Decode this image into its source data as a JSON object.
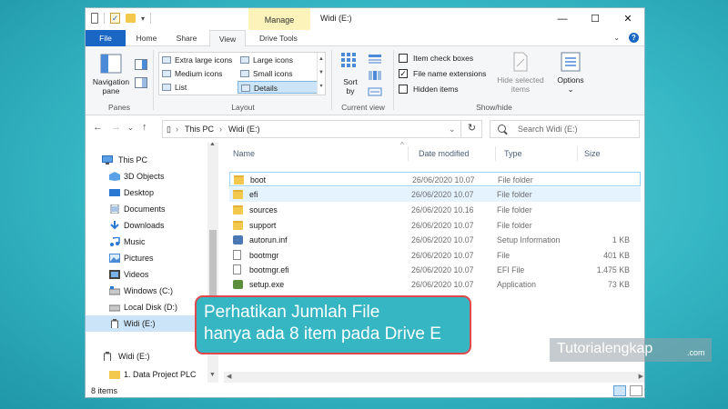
{
  "window": {
    "title": "Widi (E:)",
    "context_tab": "Manage",
    "minimize": "—",
    "maximize": "☐",
    "close": "✕"
  },
  "ribbon_tabs": [
    "File",
    "Home",
    "Share",
    "View",
    "Drive Tools"
  ],
  "ribbon": {
    "panes": {
      "nav_pane_label": "Navigation\npane",
      "group": "Panes"
    },
    "layout": {
      "items": [
        "Extra large icons",
        "Large icons",
        "Medium icons",
        "Small icons",
        "List",
        "Details"
      ],
      "selected": "Details",
      "group": "Layout"
    },
    "current_view": {
      "sort_label": "Sort\nby",
      "group": "Current view"
    },
    "show_hide": {
      "checkboxes": [
        {
          "label": "Item check boxes",
          "checked": false
        },
        {
          "label": "File name extensions",
          "checked": true
        },
        {
          "label": "Hidden items",
          "checked": false
        }
      ],
      "hide_selected": "Hide selected\nitems",
      "options": "Options",
      "group": "Show/hide"
    }
  },
  "address": {
    "segments": [
      "This PC",
      "Widi (E:)"
    ],
    "search_placeholder": "Search Widi (E:)"
  },
  "nav": {
    "items": [
      {
        "label": "This PC",
        "icon": "computer-icon"
      },
      {
        "label": "3D Objects",
        "icon": "cube-icon"
      },
      {
        "label": "Desktop",
        "icon": "desktop-icon"
      },
      {
        "label": "Documents",
        "icon": "documents-icon"
      },
      {
        "label": "Downloads",
        "icon": "download-icon"
      },
      {
        "label": "Music",
        "icon": "music-icon"
      },
      {
        "label": "Pictures",
        "icon": "pictures-icon"
      },
      {
        "label": "Videos",
        "icon": "videos-icon"
      },
      {
        "label": "Windows (C:)",
        "icon": "windows-drive-icon"
      },
      {
        "label": "Local Disk (D:)",
        "icon": "drive-icon"
      },
      {
        "label": "Widi (E:)",
        "icon": "usb-drive-icon",
        "selected": true
      },
      {
        "label": "Widi (E:)",
        "icon": "usb-drive-icon"
      },
      {
        "label": "1. Data Project PLC",
        "icon": "folder-icon"
      }
    ]
  },
  "columns": {
    "name": "Name",
    "date": "Date modified",
    "type": "Type",
    "size": "Size"
  },
  "files": [
    {
      "name": "boot",
      "date": "26/06/2020 10.07",
      "type": "File folder",
      "size": "",
      "icon": "folder-icon"
    },
    {
      "name": "efi",
      "date": "26/06/2020 10.07",
      "type": "File folder",
      "size": "",
      "icon": "folder-icon"
    },
    {
      "name": "sources",
      "date": "26/06/2020 10.16",
      "type": "File folder",
      "size": "",
      "icon": "folder-icon"
    },
    {
      "name": "support",
      "date": "26/06/2020 10.07",
      "type": "File folder",
      "size": "",
      "icon": "folder-icon"
    },
    {
      "name": "autorun.inf",
      "date": "26/06/2020 10.07",
      "type": "Setup Information",
      "size": "1 KB",
      "icon": "settings-file-icon"
    },
    {
      "name": "bootmgr",
      "date": "26/06/2020 10.07",
      "type": "File",
      "size": "401 KB",
      "icon": "file-icon"
    },
    {
      "name": "bootmgr.efi",
      "date": "26/06/2020 10.07",
      "type": "EFI File",
      "size": "1.475 KB",
      "icon": "file-icon"
    },
    {
      "name": "setup.exe",
      "date": "26/06/2020 10.07",
      "type": "Application",
      "size": "73 KB",
      "icon": "setup-app-icon"
    }
  ],
  "status": {
    "count": "8 items"
  },
  "callout": {
    "line1": "Perhatikan Jumlah File",
    "line2": "hanya ada 8 item pada Drive E"
  },
  "watermark": {
    "main": "Tutorialengkap",
    "sub": ".com"
  }
}
